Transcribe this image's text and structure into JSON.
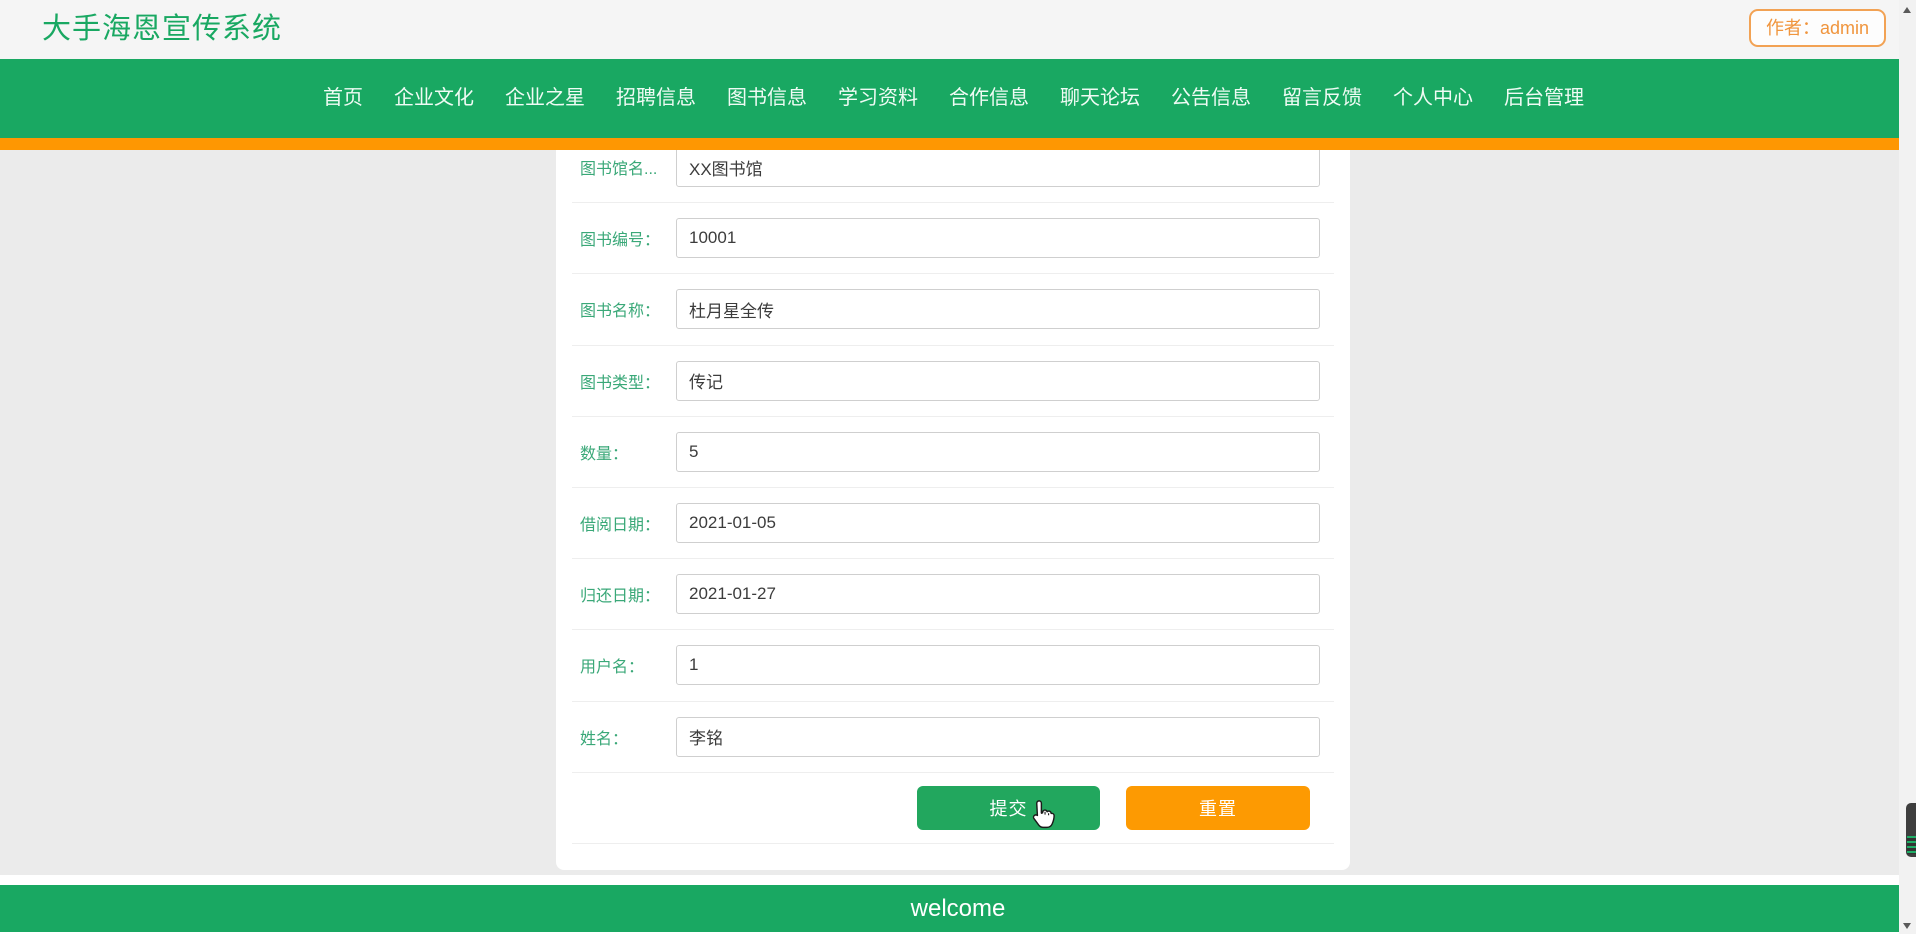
{
  "header": {
    "title": "大手海恩宣传系统",
    "author_badge": "作者：admin"
  },
  "nav": {
    "items": [
      "首页",
      "企业文化",
      "企业之星",
      "招聘信息",
      "图书信息",
      "学习资料",
      "合作信息",
      "聊天论坛",
      "公告信息",
      "留言反馈",
      "个人中心",
      "后台管理"
    ]
  },
  "form": {
    "fields": [
      {
        "label": "图书馆名...",
        "value": "XX图书馆"
      },
      {
        "label": "图书编号：",
        "value": "10001"
      },
      {
        "label": "图书名称：",
        "value": "杜月星全传"
      },
      {
        "label": "图书类型：",
        "value": "传记"
      },
      {
        "label": "数量：",
        "value": "5"
      },
      {
        "label": "借阅日期：",
        "value": "2021-01-05"
      },
      {
        "label": "归还日期：",
        "value": "2021-01-27"
      },
      {
        "label": "用户名：",
        "value": "1"
      },
      {
        "label": "姓名：",
        "value": "李铭"
      }
    ],
    "submit_label": "提交",
    "reset_label": "重置"
  },
  "footer": {
    "text": "welcome"
  },
  "colors": {
    "primary_green": "#19a862",
    "stripe_orange": "#fe9702",
    "badge_orange": "#f2a254",
    "label_green": "#3aa878",
    "submit_green": "#22a75e",
    "reset_orange": "#fd9a02"
  }
}
